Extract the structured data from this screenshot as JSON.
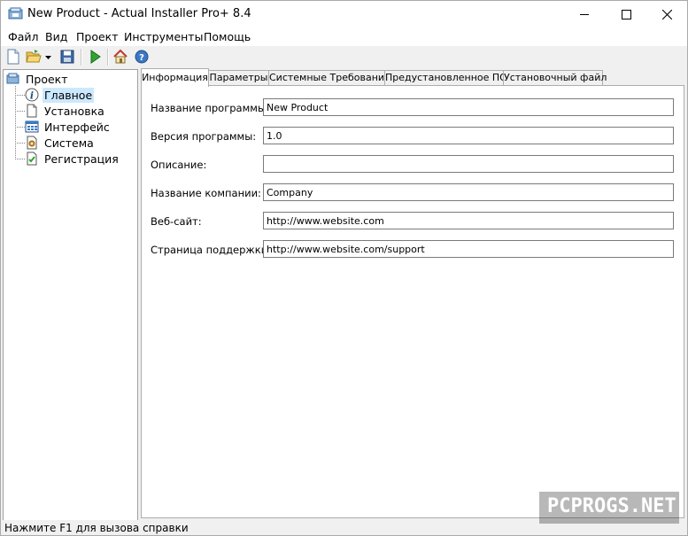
{
  "window": {
    "title": "New Product - Actual Installer Pro+ 8.4"
  },
  "menu": {
    "items": [
      "Файл",
      "Вид",
      "Проект",
      "Инструменты",
      "Помощь"
    ]
  },
  "toolbar": {
    "icons": [
      "new-document-icon",
      "open-folder-icon",
      "dropdown-arrow-icon",
      "save-icon",
      "build-run-icon",
      "home-icon",
      "help-icon"
    ]
  },
  "tree": {
    "root": "Проект",
    "items": [
      "Главное",
      "Установка",
      "Интерфейс",
      "Система",
      "Регистрация"
    ],
    "selected": "Главное"
  },
  "tabs": [
    "Информация",
    "Параметры",
    "Системные Требования",
    "Предустановленное ПО",
    "Установочный файл"
  ],
  "form": {
    "fields": [
      {
        "label": "Название программы:",
        "value": "New Product"
      },
      {
        "label": "Версия программы:",
        "value": "1.0"
      },
      {
        "label": "Описание:",
        "value": ""
      },
      {
        "label": "Название компании:",
        "value": "Company"
      },
      {
        "label": "Веб-сайт:",
        "value": "http://www.website.com"
      },
      {
        "label": "Страница поддержки:",
        "value": "http://www.website.com/support"
      }
    ]
  },
  "status": {
    "text": "Нажмите F1 для вызова справки"
  },
  "watermark": {
    "text": "PCPROGS.NET"
  },
  "colors": {
    "selection": "#cce8ff",
    "chrome": "#f0f0f0",
    "border": "#adadad"
  }
}
